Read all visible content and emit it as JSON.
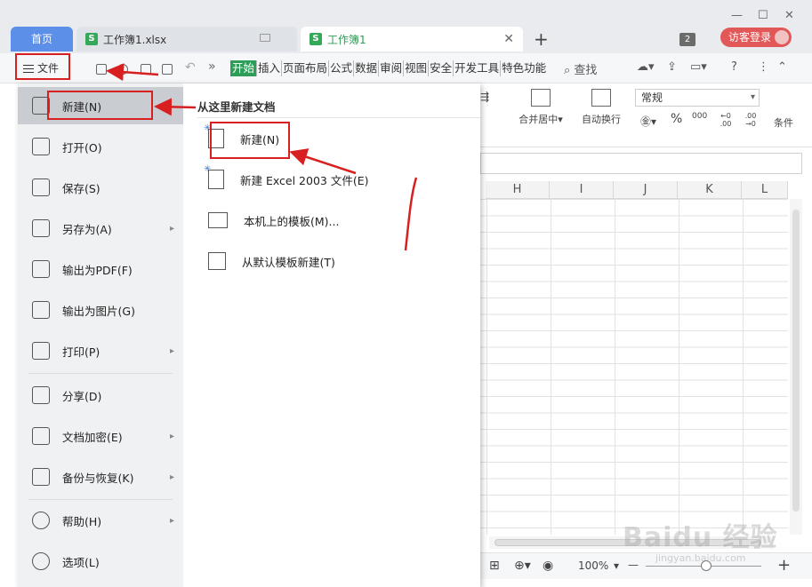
{
  "tabs": {
    "home": "首页",
    "doc1": "工作簿1.xlsx",
    "doc2": "工作簿1",
    "add": "+",
    "close": "✕",
    "sheet_icon": "S"
  },
  "window": {
    "minimize": "—",
    "maximize": "☐",
    "close": "✕"
  },
  "account": {
    "tab_count": "2",
    "guest_login": "访客登录"
  },
  "toolbar": {
    "file_label": "文件",
    "more": "»",
    "menu_tabs": [
      "开始",
      "插入",
      "页面布局",
      "公式",
      "数据",
      "审阅",
      "视图",
      "安全",
      "开发工具",
      "特色功能"
    ],
    "search": "查找",
    "help": "?",
    "more_vert": "⋮",
    "collapse": "⌃"
  },
  "ribbon": {
    "merge_center": "合并居中",
    "wrap_text": "自动换行",
    "number_format": "常规",
    "conditional": "条件",
    "percent": "%",
    "thousands": "000",
    "dec_increase": "←0 .00",
    "dec_decrease": ".00 →0"
  },
  "sheet": {
    "columns": [
      "H",
      "I",
      "J",
      "K",
      "L"
    ]
  },
  "status": {
    "zoom": "100%",
    "zoom_out": "—",
    "zoom_in": "+"
  },
  "file_menu": {
    "items": [
      {
        "label": "新建(N)",
        "icon": "new-doc-icon",
        "submenu": false
      },
      {
        "label": "打开(O)",
        "icon": "folder-icon",
        "submenu": false
      },
      {
        "label": "保存(S)",
        "icon": "save-icon",
        "submenu": false
      },
      {
        "label": "另存为(A)",
        "icon": "save-as-icon",
        "submenu": true
      },
      {
        "label": "输出为PDF(F)",
        "icon": "pdf-icon",
        "submenu": false
      },
      {
        "label": "输出为图片(G)",
        "icon": "image-icon",
        "submenu": false
      },
      {
        "label": "打印(P)",
        "icon": "print-icon",
        "submenu": true
      },
      {
        "label": "分享(D)",
        "icon": "share-icon",
        "submenu": false
      },
      {
        "label": "文档加密(E)",
        "icon": "lock-doc-icon",
        "submenu": true
      },
      {
        "label": "备份与恢复(K)",
        "icon": "backup-icon",
        "submenu": true
      },
      {
        "label": "帮助(H)",
        "icon": "help-icon",
        "submenu": true
      },
      {
        "label": "选项(L)",
        "icon": "gear-icon",
        "submenu": false
      }
    ],
    "submenu_arrow": "▸"
  },
  "new_submenu": {
    "title": "从这里新建文档",
    "items": [
      {
        "label": "新建(N)",
        "icon": "new-doc-icon"
      },
      {
        "label": "新建 Excel 2003 文件(E)",
        "icon": "new-excel-icon"
      },
      {
        "label": "本机上的模板(M)...",
        "icon": "template-icon"
      },
      {
        "label": "从默认模板新建(T)",
        "icon": "default-template-icon"
      }
    ]
  },
  "watermark": {
    "brand": "Baidu 经验",
    "url": "jingyan.baidu.com"
  },
  "colors": {
    "accent_green": "#2d9e57",
    "tab_blue": "#5b8fe8",
    "annotation_red": "#d82020",
    "guest_red": "#e25757"
  }
}
